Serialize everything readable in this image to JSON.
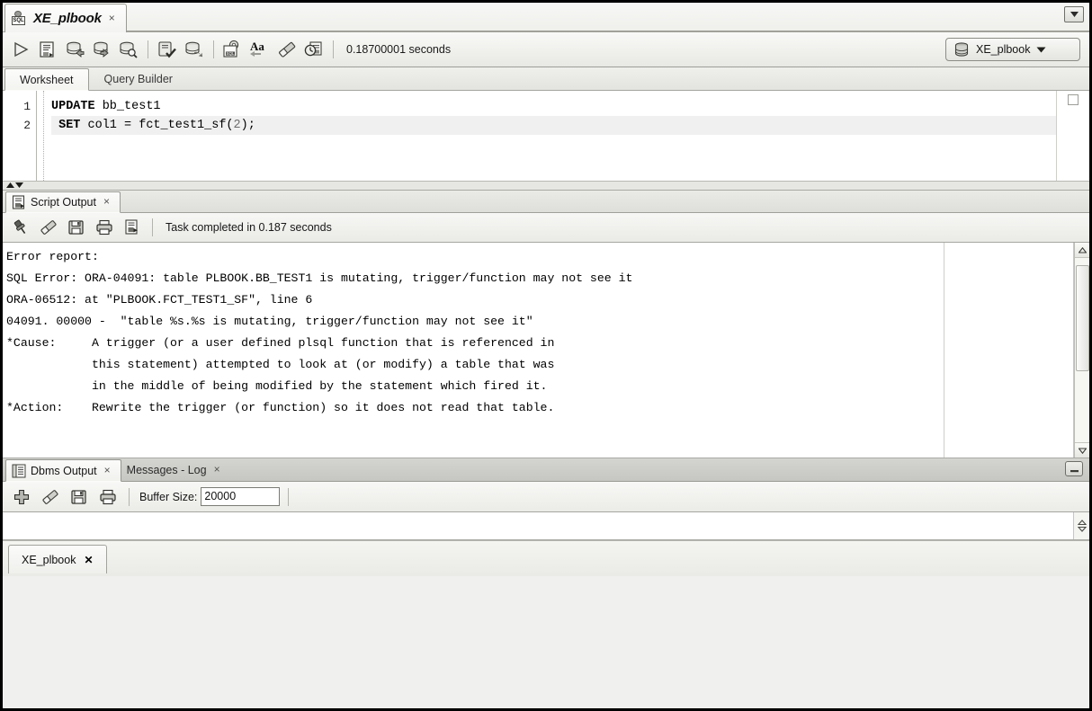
{
  "window": {
    "minimize_glyph": "▼",
    "minimize_name": "window-minimize-button"
  },
  "document_tab": {
    "title": "XE_plbook",
    "close_glyph": "×",
    "icon_label": "SQL"
  },
  "toolbar": {
    "buttons": [
      {
        "name": "run-statement-button",
        "tip": "Run Statement"
      },
      {
        "name": "run-script-button",
        "tip": "Run Script"
      },
      {
        "name": "commit-button",
        "tip": "Commit"
      },
      {
        "name": "rollback-button",
        "tip": "Rollback"
      },
      {
        "name": "unshared-sql-worksheet-button",
        "tip": "Unshared SQL Worksheet"
      },
      {
        "name": "to-upper-case-button",
        "tip": "Autotrace"
      },
      {
        "name": "explain-plan-button",
        "tip": "Explain Plan"
      },
      {
        "name": "sql-history-button",
        "tip": "SQL History"
      },
      {
        "name": "format-sql-button",
        "tip": "Aa"
      },
      {
        "name": "clear-button",
        "tip": "Clear"
      },
      {
        "name": "sql-history-clock-button",
        "tip": "SQL History"
      }
    ],
    "timing": "0.18700001 seconds",
    "connection": {
      "name": "XE_plbook",
      "caret_glyph": "▼"
    }
  },
  "worksheet_tabs": [
    {
      "label": "Worksheet",
      "active": true
    },
    {
      "label": "Query Builder",
      "active": false
    }
  ],
  "editor": {
    "gutter": [
      "1",
      "2"
    ],
    "lines": [
      {
        "keyword": "UPDATE",
        "rest": " bb_test1",
        "current": false
      },
      {
        "keyword": " SET",
        "rest": " col1 = fct_test1_sf(",
        "number": "2",
        "tail": ");",
        "current": true
      }
    ],
    "full_text": "UPDATE bb_test1\n SET col1 = fct_test1_sf(2);"
  },
  "script_output": {
    "tab_label": "Script Output",
    "close_glyph": "×",
    "toolbar_buttons": [
      {
        "name": "pin-button",
        "tip": "Pin"
      },
      {
        "name": "clear-output-button",
        "tip": "Clear"
      },
      {
        "name": "save-output-button",
        "tip": "Save"
      },
      {
        "name": "print-output-button",
        "tip": "Print"
      },
      {
        "name": "open-in-editor-button",
        "tip": "Open"
      }
    ],
    "status": "Task completed in 0.187 seconds",
    "text": "Error report:\nSQL Error: ORA-04091: table PLBOOK.BB_TEST1 is mutating, trigger/function may not see it\nORA-06512: at \"PLBOOK.FCT_TEST1_SF\", line 6\n04091. 00000 -  \"table %s.%s is mutating, trigger/function may not see it\"\n*Cause:     A trigger (or a user defined plsql function that is referenced in\n            this statement) attempted to look at (or modify) a table that was\n            in the middle of being modified by the statement which fired it.\n*Action:    Rewrite the trigger (or function) so it does not read that table.",
    "scroll_up_glyph": "︿",
    "scroll_down_glyph": "﹀"
  },
  "dbms_output": {
    "tabs": [
      {
        "label": "Dbms Output",
        "close_glyph": "×",
        "active": true
      },
      {
        "label": "Messages - Log",
        "close_glyph": "×",
        "active": false
      }
    ],
    "collapse_glyph": "▄",
    "toolbar_buttons": [
      {
        "name": "enable-dbms-output-button",
        "tip": "Enable"
      },
      {
        "name": "clear-dbms-output-button",
        "tip": "Clear"
      },
      {
        "name": "save-dbms-output-button",
        "tip": "Save"
      },
      {
        "name": "print-dbms-output-button",
        "tip": "Print"
      }
    ],
    "buffer_size_label": "Buffer Size:",
    "buffer_size_value": "20000",
    "body_text": ""
  },
  "bottom_tabs": [
    {
      "label": "XE_plbook",
      "close_glyph": "✕"
    }
  ],
  "colors": {
    "frame": "#000000",
    "toolbar_bg": "#eeeeea",
    "panel_bg": "#ffffff",
    "tab_active": "#fbfbfa",
    "dbms_tabbar_bg": "#cccccb"
  }
}
